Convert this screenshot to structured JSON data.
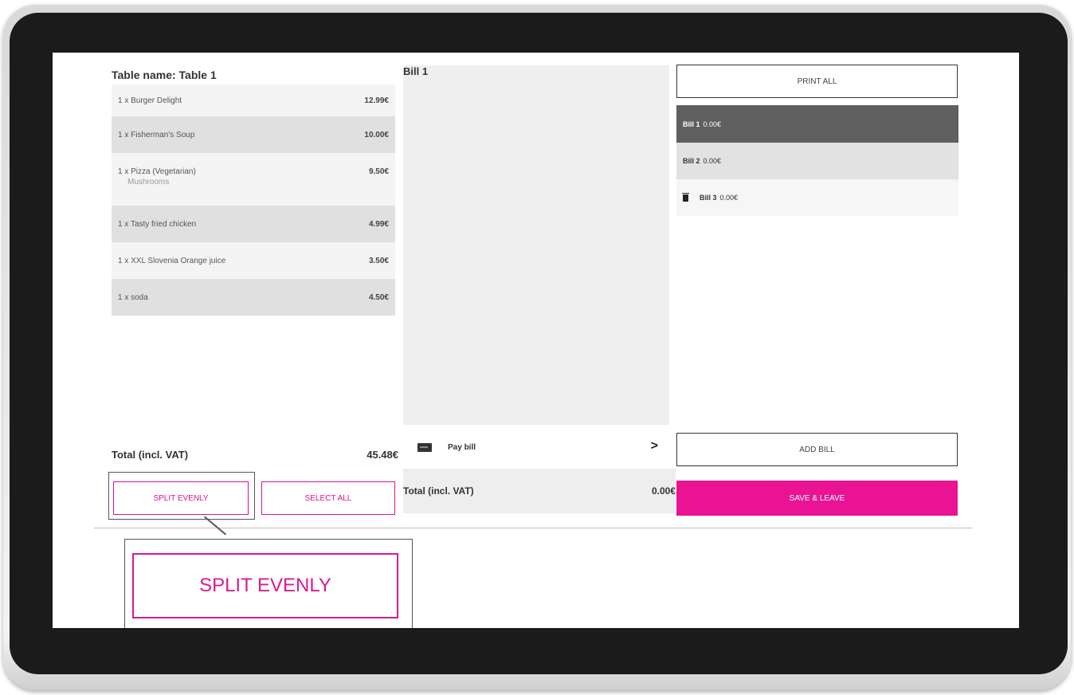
{
  "left": {
    "table_title": "Table name: Table 1",
    "items": [
      {
        "label": "1 x Burger Delight",
        "price": "12.99€",
        "modifier": ""
      },
      {
        "label": "1 x Fisherman's Soup",
        "price": "10.00€",
        "modifier": ""
      },
      {
        "label": "1 x Pizza (Vegetarian)",
        "price": "9.50€",
        "modifier": "Mushrooms"
      },
      {
        "label": "1 x Tasty fried chicken",
        "price": "4.99€",
        "modifier": ""
      },
      {
        "label": "1 x XXL Slovenia Orange juice",
        "price": "3.50€",
        "modifier": ""
      },
      {
        "label": "1 x soda",
        "price": "4.50€",
        "modifier": ""
      }
    ],
    "total_label": "Total (incl. VAT)",
    "total_value": "45.48€",
    "split_evenly_label": "SPLIT EVENLY",
    "select_all_label": "SELECT ALL"
  },
  "middle": {
    "bill_title": "Bill 1",
    "pay_label": "Pay bill",
    "total_label": "Total (incl. VAT)",
    "total_value": "0.00€"
  },
  "right": {
    "print_all_label": "PRINT ALL",
    "bills": [
      {
        "name": "Bill 1",
        "amount": "0.00€"
      },
      {
        "name": "Bill 2",
        "amount": "0.00€"
      },
      {
        "name": "Bill 3",
        "amount": "0.00€"
      }
    ],
    "add_bill_label": "ADD BILL",
    "save_leave_label": "SAVE & LEAVE"
  },
  "callout": {
    "label": "SPLIT EVENLY"
  },
  "colors": {
    "accent": "#ea1393",
    "selected_bill": "#5f5f5f",
    "panel_bg": "#efefef"
  },
  "icons": {
    "pay": "card-icon",
    "delete": "trash-icon",
    "next": "chevron-right-icon"
  }
}
